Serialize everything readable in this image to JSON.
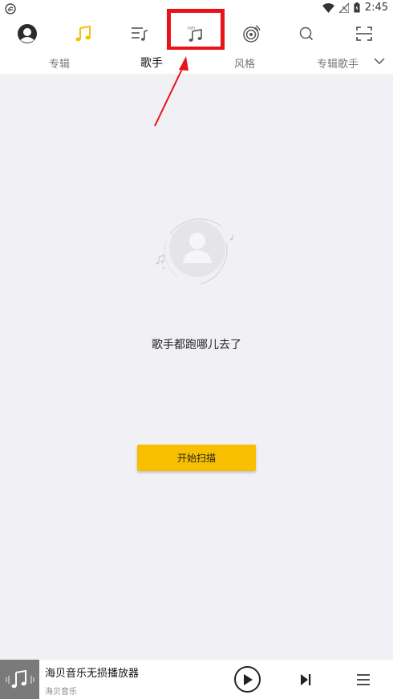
{
  "status_bar": {
    "time": "2:45",
    "icons": [
      "app-notification-icon",
      "wifi-icon",
      "signal-off-icon",
      "battery-icon"
    ]
  },
  "top_nav": {
    "items": [
      {
        "icon": "user-avatar-icon",
        "active": false
      },
      {
        "icon": "local-music-icon",
        "active": true
      },
      {
        "icon": "playlist-icon",
        "active": false
      },
      {
        "icon": "hifi-music-icon",
        "active": false,
        "highlighted": true
      },
      {
        "icon": "radio-disc-icon",
        "active": false
      },
      {
        "icon": "search-icon",
        "active": false
      },
      {
        "icon": "scan-icon",
        "active": false
      }
    ]
  },
  "sub_tabs": {
    "items": [
      {
        "label": "专辑",
        "active": false
      },
      {
        "label": "歌手",
        "active": true
      },
      {
        "label": "风格",
        "active": false
      },
      {
        "label": "专辑歌手",
        "active": false
      }
    ]
  },
  "empty_state": {
    "message": "歌手都跑哪儿去了",
    "button_label": "开始扫描"
  },
  "mini_player": {
    "title": "海贝音乐无损播放器",
    "artist": "海贝音乐"
  },
  "colors": {
    "accent": "#f8bf00",
    "annotation": "#e8121a",
    "background": "#f1f0f5"
  }
}
